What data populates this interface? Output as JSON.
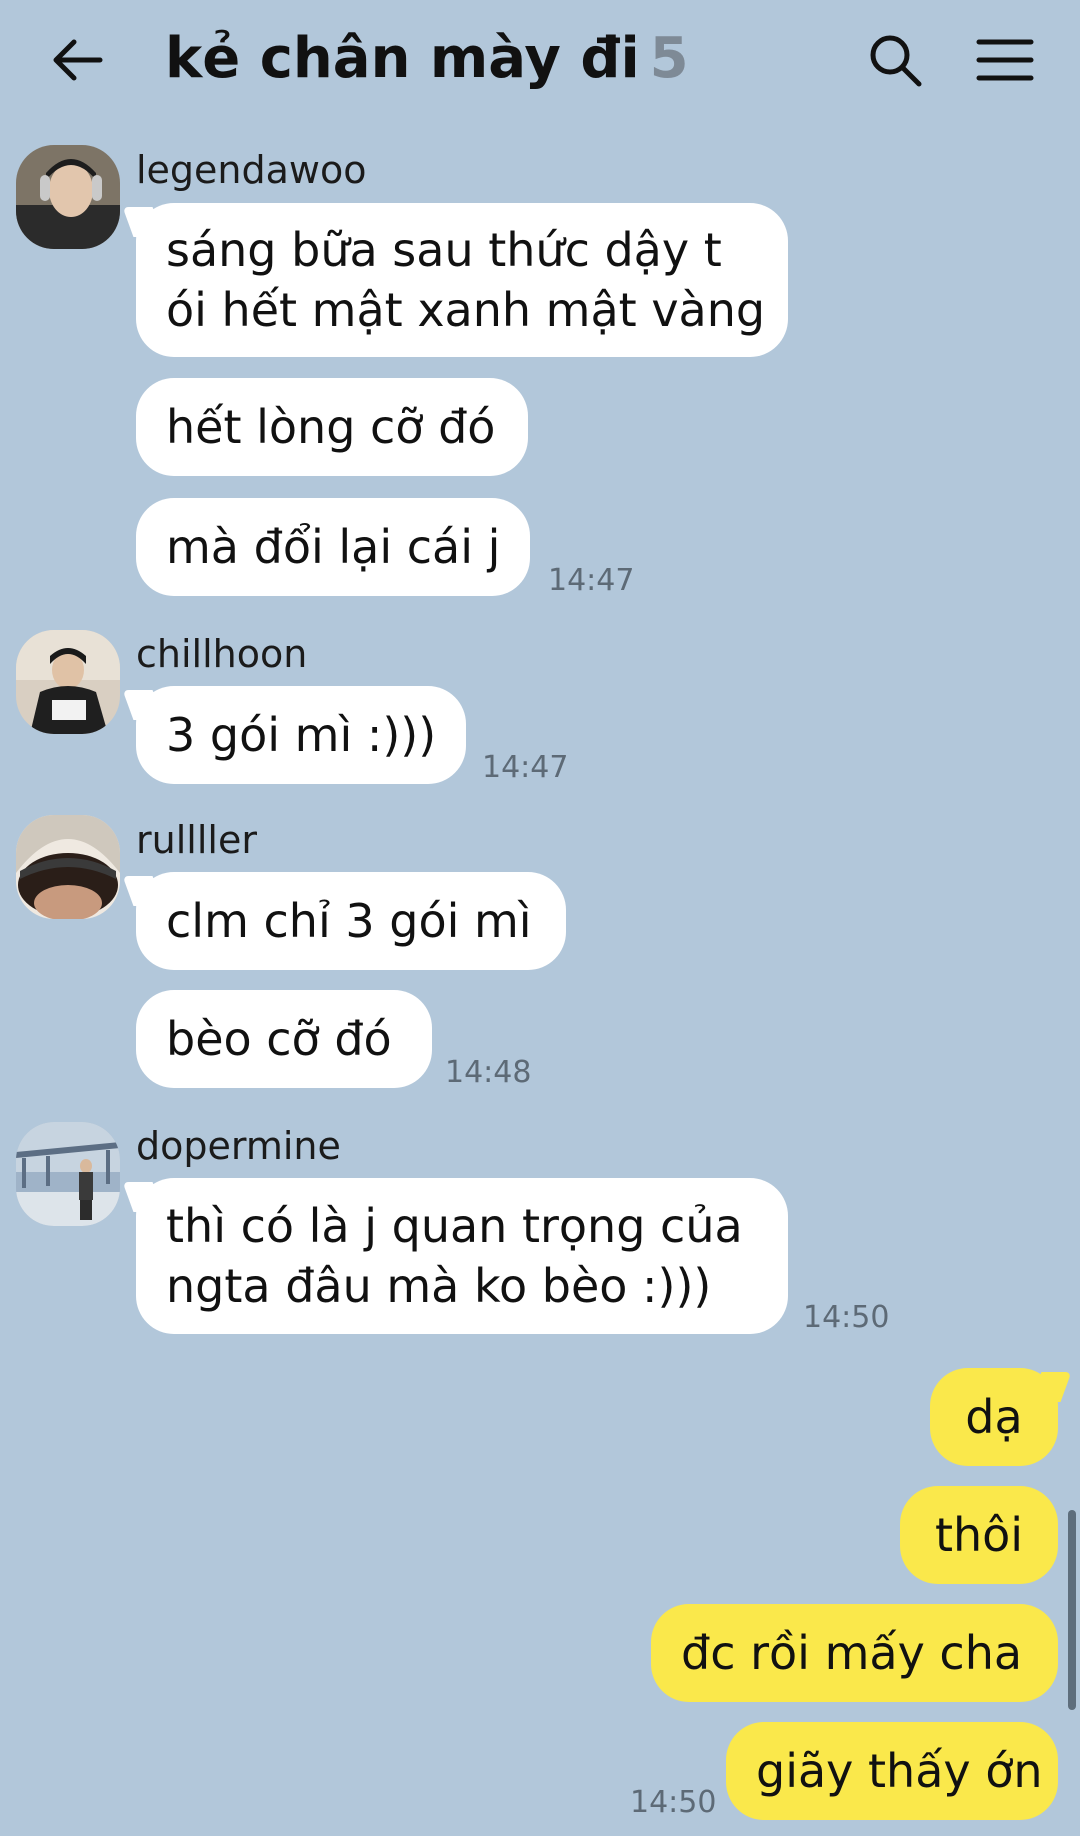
{
  "header": {
    "title": "kẻ chân mày đi",
    "member_count": "5",
    "back_icon": "back-arrow-icon",
    "search_icon": "search-icon",
    "menu_icon": "hamburger-menu-icon"
  },
  "messages": [
    {
      "sender": "legendawoo",
      "lines": [
        "sáng bữa sau thức dậy t",
        "ói hết mật xanh mật vàng"
      ]
    },
    {
      "lines": [
        "hết lòng cỡ đó"
      ]
    },
    {
      "lines": [
        "mà đổi lại cái j"
      ],
      "time": "14:47"
    },
    {
      "sender": "chillhoon",
      "lines": [
        "3 gói mì :)))"
      ],
      "time": "14:47"
    },
    {
      "sender": "rullller",
      "lines": [
        "clm chỉ 3 gói mì"
      ]
    },
    {
      "lines": [
        "bèo cỡ đó"
      ],
      "time": "14:48"
    },
    {
      "sender": "dopermine",
      "lines": [
        "thì có là j quan trọng của",
        "ngta đâu mà ko bèo :)))"
      ],
      "time": "14:50"
    },
    {
      "lines": [
        "dạ"
      ]
    },
    {
      "lines": [
        "thôi"
      ]
    },
    {
      "lines": [
        "đc rồi mấy cha"
      ]
    },
    {
      "lines": [
        "giãy thấy ớn"
      ],
      "time": "14:50"
    }
  ],
  "colors": {
    "background": "#b2c7da",
    "incoming_bubble": "#ffffff",
    "outgoing_bubble": "#fae84b",
    "timestamp": "#5d6a76"
  }
}
